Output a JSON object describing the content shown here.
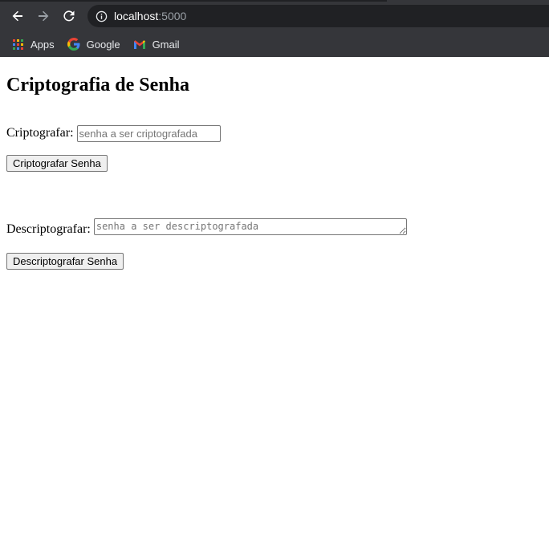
{
  "browser": {
    "url_host": "localhost",
    "url_port": ":5000",
    "bookmarks": [
      {
        "label": "Apps",
        "icon": "apps-grid-icon"
      },
      {
        "label": "Google",
        "icon": "google-icon"
      },
      {
        "label": "Gmail",
        "icon": "gmail-icon"
      }
    ]
  },
  "page": {
    "title": "Criptografia de Senha",
    "encrypt": {
      "label": "Criptografar:",
      "placeholder": "senha a ser criptografada",
      "value": "",
      "button": "Criptografar Senha"
    },
    "decrypt": {
      "label": "Descriptografar:",
      "placeholder": "senha a ser descriptografada",
      "value": "",
      "button": "Descriptografar Senha"
    }
  },
  "colors": {
    "chrome_bg": "#35363a",
    "omnibox_bg": "#202124",
    "page_bg": "#ffffff"
  }
}
